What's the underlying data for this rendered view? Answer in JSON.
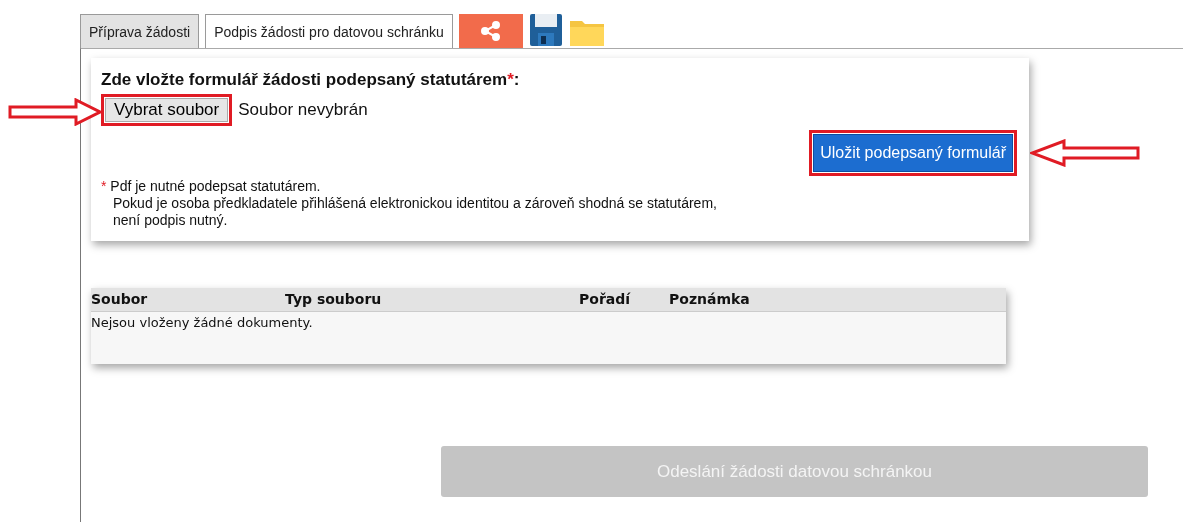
{
  "tabs": [
    {
      "label": "Příprava žádosti",
      "selected": false
    },
    {
      "label": "Podpis žádosti pro datovou schránku",
      "selected": true
    }
  ],
  "upload": {
    "title": "Zde vložte formulář žádosti podepsaný statutárem",
    "required_mark": "*",
    "title_suffix": ":",
    "file_button": "Vybrat soubor",
    "file_status": "Soubor nevybrán",
    "save_button": "Uložit podepsaný formulář",
    "note": {
      "mark": "*",
      "lines": [
        "Pdf je nutné podepsat statutárem.",
        "Pokud je osoba předkladatele přihlášená elektronickou identitou a zároveň shodná se statutárem,",
        "není podpis nutný."
      ]
    }
  },
  "table": {
    "columns": [
      "Soubor",
      "Typ souboru",
      "Pořadí",
      "Poznámka"
    ],
    "empty_message": "Nejsou vloženy žádné dokumenty."
  },
  "submit_button": {
    "label": "Odeslání žádosti datovou schránkou",
    "disabled": true
  }
}
